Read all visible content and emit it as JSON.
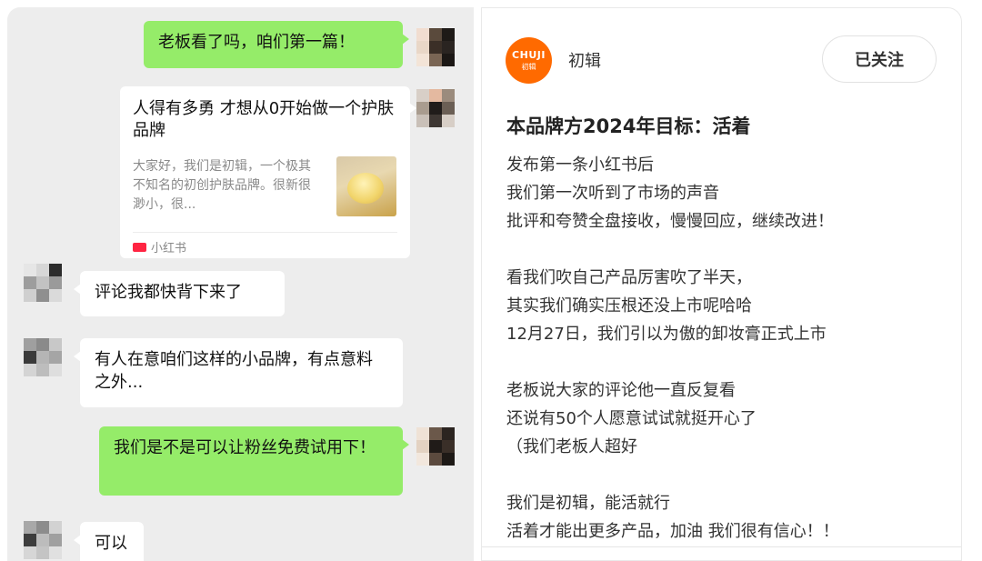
{
  "chat": {
    "messages": [
      {
        "from": "me",
        "text": "老板看了吗，咱们第一篇！"
      },
      {
        "from": "me",
        "type": "card",
        "title": "人得有多勇 才想从0开始做一个护肤品牌",
        "desc": "大家好，我们是初辑，一个极其不知名的初创护肤品牌。很新很渺小，很...",
        "source": "小红书"
      },
      {
        "from": "other",
        "text": "评论我都快背下来了"
      },
      {
        "from": "other",
        "text": "有人在意咱们这样的小品牌，有点意料之外..."
      },
      {
        "from": "me",
        "text": "我们是不是可以让粉丝免费试用下！"
      },
      {
        "from": "other",
        "text": "可以"
      }
    ]
  },
  "post": {
    "logo_text": "CHUJI",
    "logo_sub": "初辑",
    "author": "初辑",
    "follow_label": "已关注",
    "title": "本品牌方2024年目标：活着",
    "lines": [
      "发布第一条小红书后",
      "我们第一次听到了市场的声音",
      "批评和夸赞全盘接收，慢慢回应，继续改进！",
      "",
      "看我们吹自己产品厉害吹了半天，",
      "其实我们确实压根还没上市呢哈哈",
      "12月27日，我们引以为傲的卸妆膏正式上市",
      "",
      "老板说大家的评论他一直反复看",
      "还说有50个人愿意试试就挺开心了",
      "（我们老板人超好",
      "",
      "我们是初辑，能活就行",
      "活着才能出更多产品，加油 我们很有信心！！"
    ]
  }
}
